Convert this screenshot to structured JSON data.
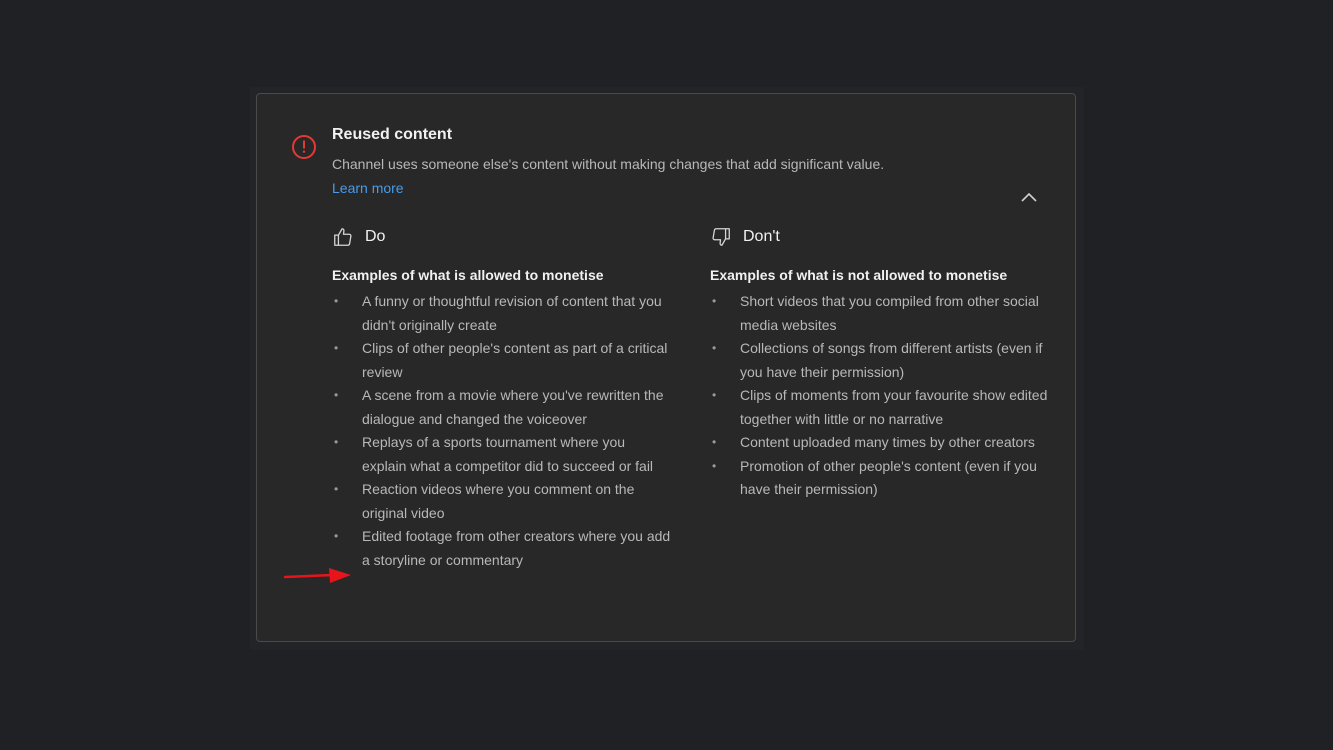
{
  "card": {
    "title": "Reused content",
    "description": "Channel uses someone else's content without making changes that add significant value.",
    "learn_more": "Learn more",
    "warn_color": "#e53935",
    "link_color": "#4a9be8"
  },
  "do": {
    "heading": "Do",
    "icon": "thumbs-up-icon",
    "subheading": "Examples of what is allowed to monetise",
    "items": [
      "A funny or thoughtful revision of content that you didn't originally create",
      "Clips of other people's content as part of a critical review",
      "A scene from a movie where you've rewritten the dialogue and changed the voiceover",
      "Replays of a sports tournament where you explain what a competitor did to succeed or fail",
      "Reaction videos where you comment on the original video",
      "Edited footage from other creators where you add a storyline or commentary"
    ]
  },
  "dont": {
    "heading": "Don't",
    "icon": "thumbs-down-icon",
    "subheading": "Examples of what is not allowed to monetise",
    "items": [
      "Short videos that you compiled from other social media websites",
      "Collections of songs from different artists (even if you have their permission)",
      "Clips of moments from your favourite show edited together with little or no narrative",
      "Content uploaded many times by other creators",
      "Promotion of other people's content (even if you have their permission)"
    ]
  },
  "annotation": {
    "arrow_color": "#e8141b",
    "icon": "red-arrow-icon"
  }
}
